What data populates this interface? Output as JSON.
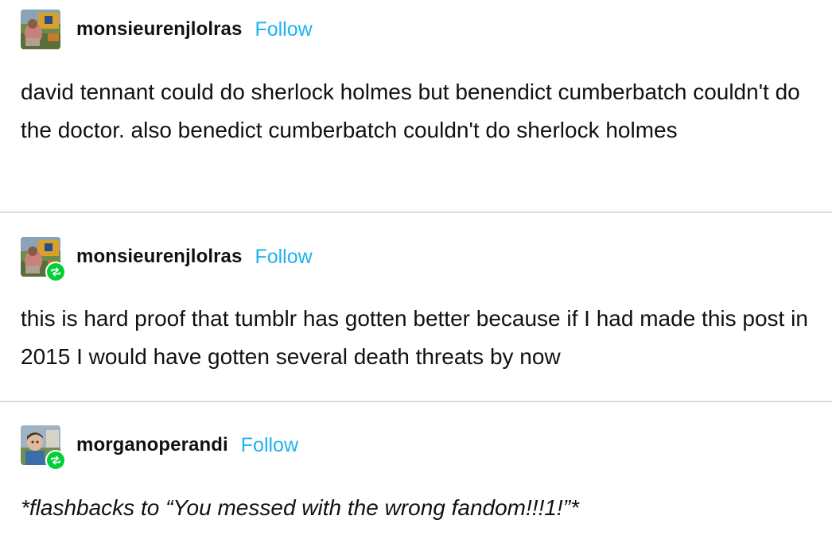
{
  "posts": [
    {
      "username": "monsieurenjlolras",
      "follow_label": "Follow",
      "reblog": false,
      "text": "david tennant could do sherlock holmes but benendict cumberbatch couldn't do the doctor. also benedict cumberbatch couldn't do sherlock holmes"
    },
    {
      "username": "monsieurenjlolras",
      "follow_label": "Follow",
      "reblog": true,
      "text": "this is hard proof that tumblr has gotten better because if I had made this post in 2015 I would have gotten several death threats by now"
    },
    {
      "username": "morganoperandi",
      "follow_label": "Follow",
      "reblog": true,
      "text": "*flashbacks to “You messed with the wrong fandom!!!1!”*"
    }
  ],
  "colors": {
    "follow": "#1eb3f0",
    "reblog_badge": "#00cf35",
    "divider": "#dddddd",
    "text": "#111111"
  },
  "icons": {
    "avatar": "user-avatar",
    "reblog": "reblog-icon"
  }
}
